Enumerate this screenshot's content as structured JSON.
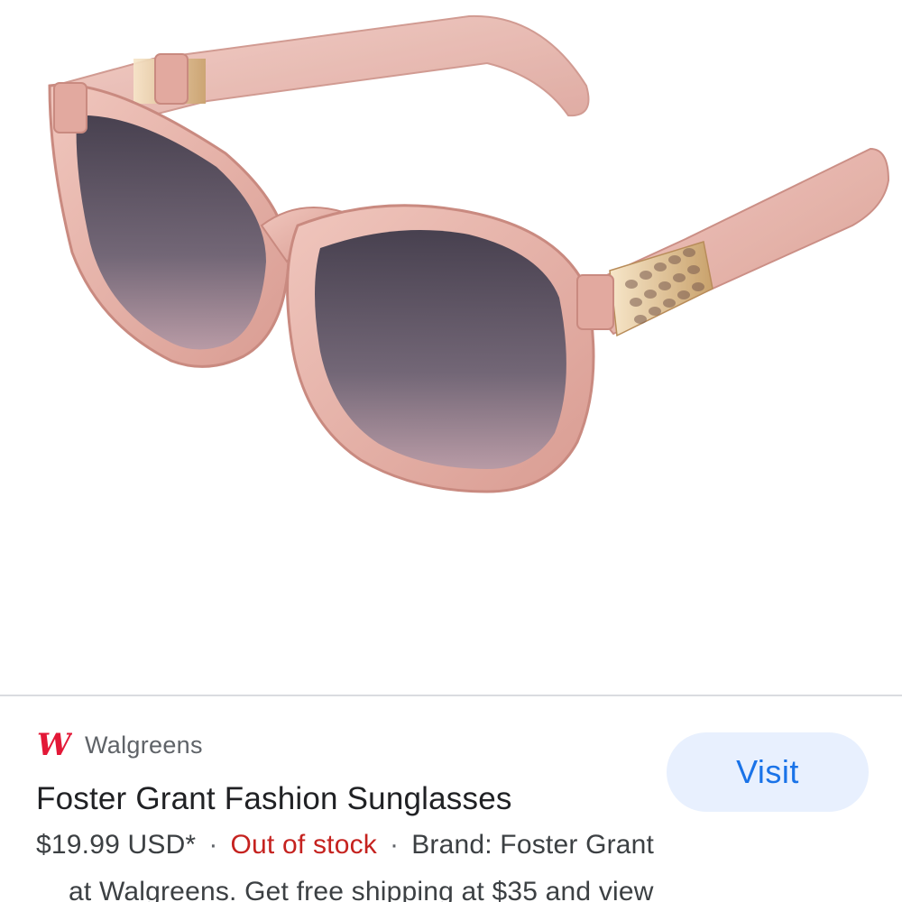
{
  "product_image": {
    "alt": "Foster Grant Fashion Sunglasses",
    "frame_color": "#e7b3ab",
    "lens_color": "#4b4656"
  },
  "store": {
    "logo_icon": "walgreens-w-icon",
    "logo_text": "W",
    "logo_color": "#e31837",
    "name": "Walgreens"
  },
  "visit_button": {
    "label": "Visit"
  },
  "product": {
    "title": "Foster Grant Fashion Sunglasses",
    "price": "$19.99 USD*",
    "separator": "·",
    "stock_status": "Out of stock",
    "brand": "Brand: Foster Grant",
    "description": "at Walgreens. Get free shipping at $35 and view"
  },
  "colors": {
    "accent": "#1a73e8",
    "accent_bg": "#e8f0fe",
    "stock_red": "#c5221f",
    "divider": "#dadce0"
  }
}
